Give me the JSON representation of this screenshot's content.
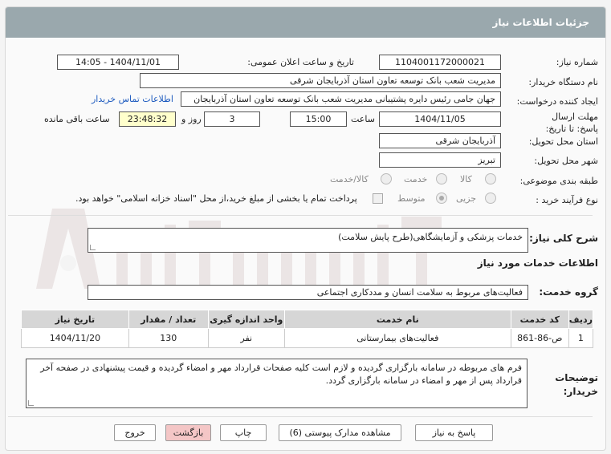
{
  "header": {
    "title": "جزئیات اطلاعات نیاز"
  },
  "form": {
    "need_number_label": "شماره نیاز:",
    "need_number": "1104001172000021",
    "announce_label": "تاریخ و ساعت اعلان عمومی:",
    "announce_value": "1404/11/01 - 14:05",
    "buyer_label": "نام دستگاه خریدار:",
    "buyer_value": "مدیریت شعب بانک توسعه تعاون استان آذربایجان شرقی",
    "creator_label": "ایجاد کننده درخواست:",
    "creator_value": "جهان جامی رئیس دایره پشتیبانی مدیریت شعب بانک توسعه تعاون استان آذربایجان",
    "contact_link": "اطلاعات تماس خریدار",
    "deadline_label": "مهلت ارسال پاسخ: تا تاریخ:",
    "deadline_date": "1404/11/05",
    "time_label": "ساعت",
    "deadline_time": "15:00",
    "days_value": "3",
    "days_label": "روز و",
    "remaining_value": "23:48:32",
    "remaining_label": "ساعت باقی مانده",
    "province_label": "استان محل تحویل:",
    "province_value": "آذربایجان شرقی",
    "city_label": "شهر محل تحویل:",
    "city_value": "تبریز",
    "category_label": "طبقه بندی موضوعی:",
    "category_options": [
      "کالا",
      "خدمت",
      "کالا/خدمت"
    ],
    "category_selected": "خدمت",
    "purchase_label": "نوع فرآیند خرید :",
    "purchase_options": [
      "جزیی",
      "متوسط"
    ],
    "purchase_selected": "متوسط",
    "payment_note": "پرداخت تمام یا بخشی از مبلغ خرید،از محل \"اسناد خزانه اسلامی\" خواهد بود."
  },
  "description": {
    "label": "شرح کلی نیاز:",
    "value": "خدمات پزشکی و آزمایشگاهی(طرح پایش سلامت)"
  },
  "services": {
    "section_title": "اطلاعات خدمات مورد نیاز",
    "group_label": "گروه خدمت:",
    "group_value": "فعالیت‌های مربوط به سلامت انسان و مددکاری اجتماعی",
    "columns": [
      "ردیف",
      "کد خدمت",
      "نام خدمت",
      "واحد اندازه گیری",
      "تعداد / مقدار",
      "تاریخ نیاز"
    ],
    "rows": [
      [
        "1",
        "ص-86-861",
        "فعالیت‌های بیمارستانی",
        "نفر",
        "130",
        "1404/11/20"
      ]
    ]
  },
  "buyer_notes": {
    "label": "توضیحات خریدار:",
    "value": "فرم های مربوطه در سامانه بارگزاری گردیده و لازم است کلیه صفحات قرارداد مهر و امضاء گردیده و قیمت پیشنهادی در صفحه آخر قرارداد پس از مهر و امضاء در سامانه بارگزاری گردد."
  },
  "buttons": {
    "reply": "پاسخ به نیاز",
    "attachments": "مشاهده مدارک پیوستی (6)",
    "print": "چاپ",
    "back": "بازگشت",
    "exit": "خروج"
  },
  "colors": {
    "header_bg": "#9aa8ad",
    "link": "#1e5bbf",
    "remaining_bg": "#ffffcc",
    "pink_button": "#f4c6c6"
  }
}
